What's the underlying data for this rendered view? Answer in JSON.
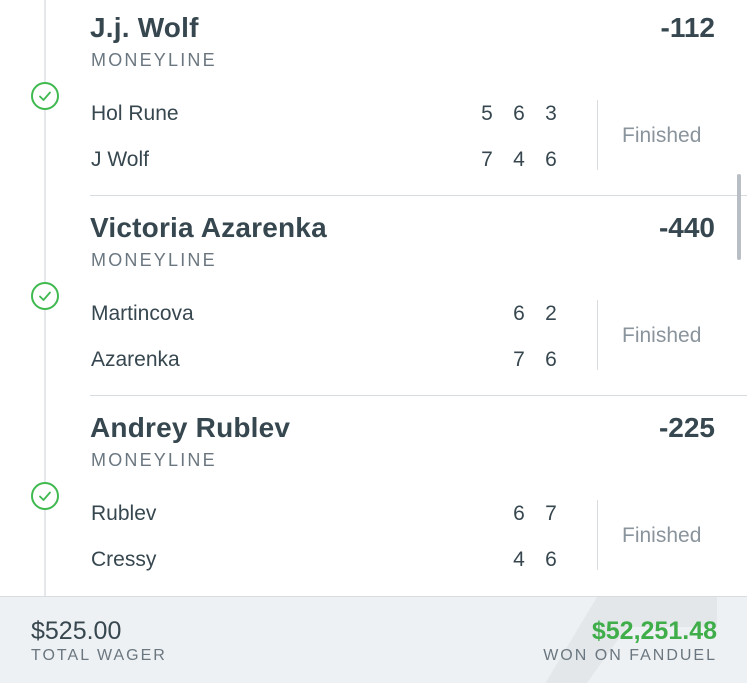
{
  "legs": [
    {
      "selection": "J.j. Wolf",
      "odds": "-112",
      "market": "MONEYLINE",
      "status": "Finished",
      "result_icon": "check-circle-icon",
      "players": [
        {
          "name": "Hol Rune",
          "scores": [
            "5",
            "6",
            "3"
          ]
        },
        {
          "name": "J Wolf",
          "scores": [
            "7",
            "4",
            "6"
          ]
        }
      ]
    },
    {
      "selection": "Victoria Azarenka",
      "odds": "-440",
      "market": "MONEYLINE",
      "status": "Finished",
      "result_icon": "check-circle-icon",
      "players": [
        {
          "name": "Martincova",
          "scores": [
            "6",
            "2"
          ]
        },
        {
          "name": "Azarenka",
          "scores": [
            "7",
            "6"
          ]
        }
      ]
    },
    {
      "selection": "Andrey Rublev",
      "odds": "-225",
      "market": "MONEYLINE",
      "status": "Finished",
      "result_icon": "check-circle-icon",
      "players": [
        {
          "name": "Rublev",
          "scores": [
            "6",
            "7"
          ]
        },
        {
          "name": "Cressy",
          "scores": [
            "4",
            "6"
          ]
        }
      ]
    }
  ],
  "footer": {
    "total_wager": "$525.00",
    "total_wager_label": "TOTAL WAGER",
    "won_amount": "$52,251.48",
    "won_label": "WON ON FANDUEL"
  },
  "colors": {
    "success": "#3fb950",
    "won": "#3fae4a",
    "text": "#37474f",
    "muted": "#6b7780"
  }
}
